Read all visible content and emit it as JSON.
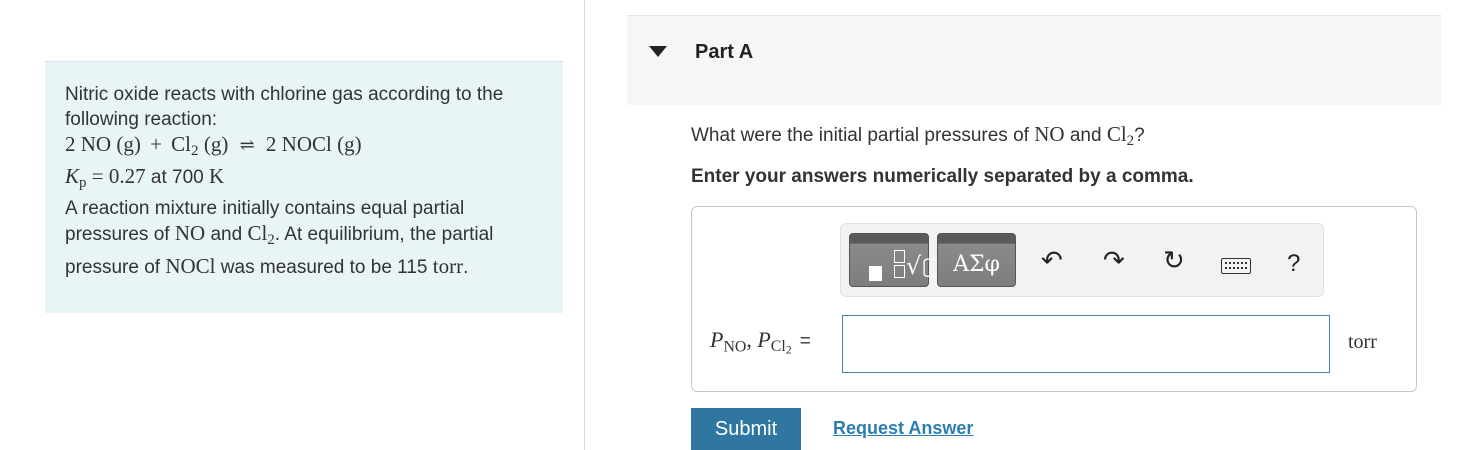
{
  "problem": {
    "intro": "Nitric oxide reacts with chlorine gas according to the following reaction:",
    "reactant1": "2 NO (g)",
    "plus": "+",
    "reactant2_main": "Cl",
    "reactant2_sub": "2",
    "reactant2_state": " (g)",
    "equilibrium_arrow": "⇌",
    "product": "2 NOCl (g)",
    "kp_symbol": "K",
    "kp_sub": "p",
    "kp_eq": " = 0.27",
    "kp_at": " at 700 ",
    "kp_unit": "K",
    "body_1": "A reaction mixture initially contains equal partial pressures of ",
    "body_no": "NO",
    "body_and": " and ",
    "body_cl": "Cl",
    "body_cl_sub": "2",
    "body_2": ". At equilibrium, the partial pressure of ",
    "body_nocl": "NOCl",
    "body_3": " was measured to be 115 ",
    "body_torr": "torr",
    "body_end": "."
  },
  "part": {
    "title": "Part A"
  },
  "question": {
    "prefix": "What were the initial partial pressures of ",
    "no": "NO",
    "and": " and ",
    "cl": "Cl",
    "cl_sub": "2",
    "suffix": "?"
  },
  "instruction": "Enter your answers numerically separated by a comma.",
  "toolbar": {
    "templates_icon": "templates-icon",
    "sqrt_glyph": "√▢",
    "symbols_label": "ΑΣφ",
    "undo_glyph": "↶",
    "redo_glyph": "↷",
    "reset_glyph": "↻",
    "keyboard_icon": "keyboard-icon",
    "help_label": "?"
  },
  "answer": {
    "var1": "P",
    "var1_sub": "NO",
    "comma": ", ",
    "var2": "P",
    "var2_sub_main": "Cl",
    "var2_sub_sub": "2",
    "equals": "=",
    "value": "",
    "units": "torr"
  },
  "actions": {
    "submit": "Submit",
    "request_answer": "Request Answer"
  },
  "colors": {
    "problem_bg": "#e9f4f7",
    "submit_bg": "#2f77a0",
    "link": "#2d7db3",
    "input_border": "#4a7fa6"
  }
}
